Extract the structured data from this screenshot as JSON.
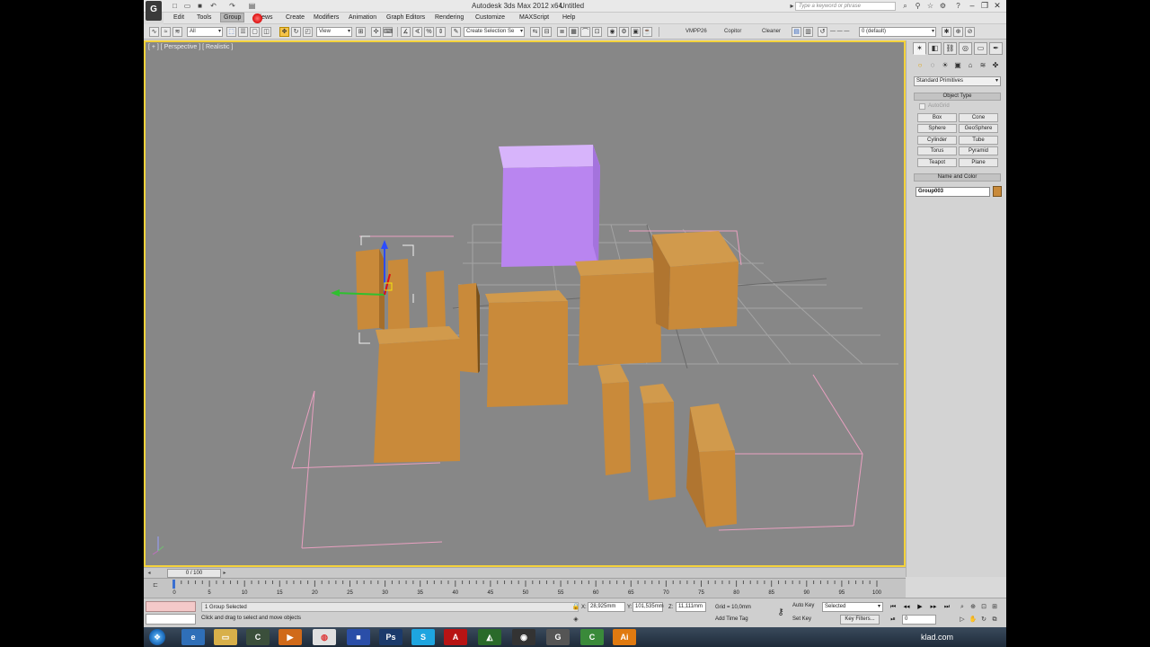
{
  "window": {
    "app_title": "Autodesk 3ds Max  2012 x64",
    "doc_title": "Untitled",
    "search_placeholder": "Type a keyword or phrase",
    "logo": "3ds-max-logo"
  },
  "menu": {
    "items": [
      "Edit",
      "Tools",
      "Group",
      "Views",
      "Create",
      "Modifiers",
      "Animation",
      "Graph Editors",
      "Rendering",
      "Customize",
      "MAXScript",
      "Help"
    ],
    "active_index": 2
  },
  "toolbar": {
    "filter_dd": "All",
    "ref_coord_dd": "View",
    "selection_set_dd": "Create Selection Se",
    "plugins": [
      "VMPP26",
      "Copitor",
      "Cleaner"
    ],
    "layer_dd": "0 (default)"
  },
  "viewport": {
    "label": "[ + ] [ Perspective ] [ Realistic ]"
  },
  "command_panel": {
    "category_dd": "Standard Primitives",
    "object_type_title": "Object Type",
    "autogrid_label": "AutoGrid",
    "primitives": [
      "Box",
      "Cone",
      "Sphere",
      "GeoSphere",
      "Cylinder",
      "Tube",
      "Torus",
      "Pyramid",
      "Teapot",
      "Plane"
    ],
    "name_color_title": "Name and Color",
    "object_name": "Group003",
    "object_color": "#c98a3a"
  },
  "time": {
    "slider_label": "0 / 100",
    "ticks": [
      "0",
      "5",
      "10",
      "15",
      "20",
      "25",
      "30",
      "35",
      "40",
      "45",
      "50",
      "55",
      "60",
      "65",
      "70",
      "75",
      "80",
      "85",
      "90",
      "95",
      "100"
    ]
  },
  "status": {
    "prompt": "1 Group Selected",
    "hint": "Click and drag to select and move objects",
    "x_label": "X:",
    "x_value": "28,925mm",
    "y_label": "Y:",
    "y_value": "101,535mm",
    "z_label": "Z:",
    "z_value": "11,111mm",
    "grid": "Grid = 10,0mm",
    "add_time_tag": "Add Time Tag",
    "auto_key": "Auto Key",
    "set_key": "Set Key",
    "selected_dd": "Selected",
    "key_filters": "Key Filters...",
    "frame_value": "0"
  },
  "taskbar": {
    "apps": [
      "ie",
      "explorer",
      "cinema4d",
      "media-player",
      "chrome",
      "save",
      "photoshop",
      "skype",
      "acrobat",
      "nvidia",
      "camera",
      "3dsmax",
      "cinema4d-green",
      "illustrator"
    ],
    "watermark": "klad.com"
  },
  "colors": {
    "box_orange": "#c98a3a",
    "box_purple": "#b985f0",
    "viewport_bg": "#878787",
    "active_border": "#f4d23b",
    "selection_pink": "#e8a0c0"
  }
}
